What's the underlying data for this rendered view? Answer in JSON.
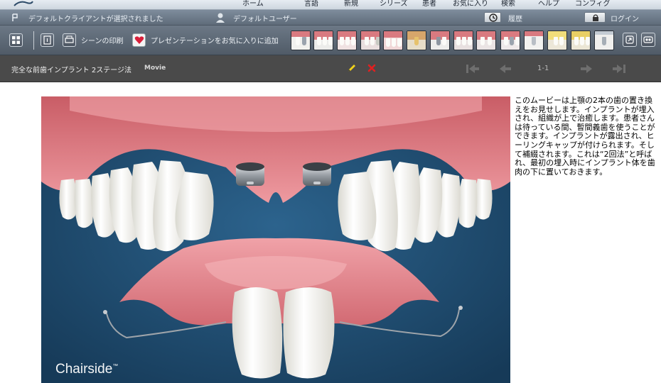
{
  "menu": {
    "items": [
      "ホーム",
      "言語",
      "新規",
      "シリーズ",
      "患者",
      "お気に入り",
      "検索",
      "ヘルプ",
      "コンフィグ"
    ]
  },
  "status": {
    "client": "デフォルトクライアントが選択されました",
    "user": "デフォルトユーザー",
    "history": "履歴",
    "login": "ログイン"
  },
  "toolbar": {
    "print_label": "シーンの印刷",
    "favorite_label": "プレゼンテーションをお気に入りに追加"
  },
  "titlebar": {
    "title": "完全な前歯インプラント 2ステージ法",
    "badge": "Movie",
    "page": "1-1"
  },
  "content": {
    "description": "このムービーは上顎の2本の歯の置き換えをお見せします。インプラントが埋入され、組織が上で治癒します。患者さんは待っている間、暫間義歯を使うことができます。インプラントが露出され、ヒーリングキャップが付けられます。そして補綴されます。これは“2回法”と呼ばれ、最初の埋入時にインプラント体を歯肉の下に置いておきます。",
    "watermark": "Chairside",
    "trademark": "™"
  },
  "colors": {
    "stage_bg": "#1f4e73",
    "gum": "#e58e93",
    "tooth": "#f7f6f1",
    "titlebar": "#4a4a4a",
    "pencil": "#f1d21a",
    "delete": "#e02020"
  }
}
